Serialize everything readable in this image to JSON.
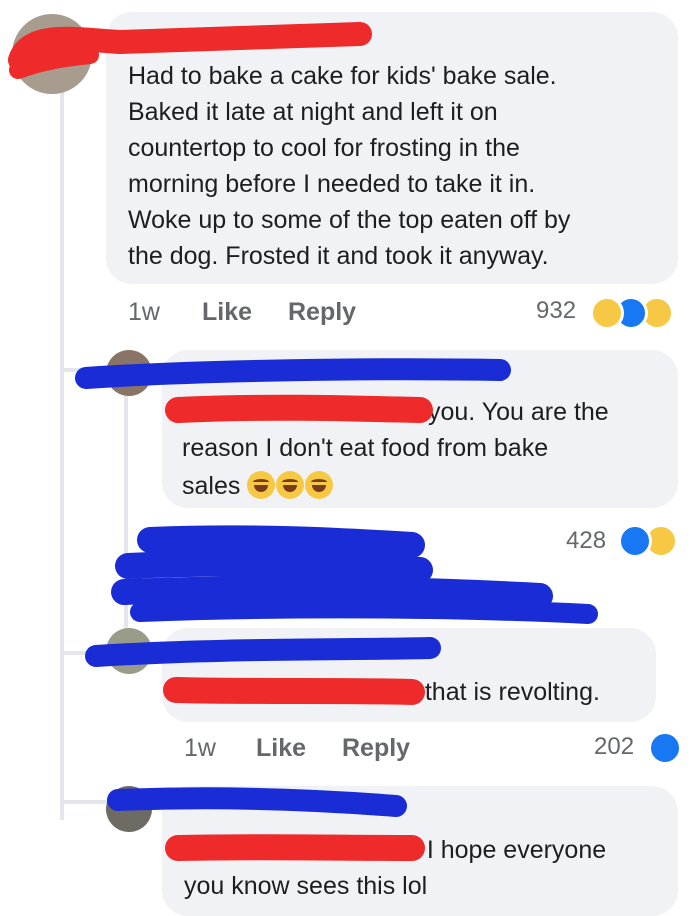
{
  "comments": [
    {
      "text_lines": [
        "Had to bake a cake for kids' bake sale.",
        "Baked it late at night and left it on",
        "countertop to cool for frosting in the",
        "morning before I needed to take it in.",
        "Woke up to some of the top eaten off by",
        "the dog.  Frosted it and took it anyway."
      ],
      "time": "1w",
      "like_label": "Like",
      "reply_label": "Reply",
      "reaction_count": "932",
      "reactions": [
        "haha",
        "like",
        "wow"
      ]
    },
    {
      "text_lines": [
        "you. You are the",
        "reason I don't eat food from bake",
        "sales"
      ],
      "emojis": [
        "tears-of-joy",
        "tears-of-joy",
        "tears-of-joy"
      ],
      "reaction_count": "428",
      "reactions": [
        "like",
        "haha"
      ]
    },
    {
      "text_lines": [
        "e that is revolting."
      ],
      "time": "1w",
      "like_label": "Like",
      "reply_label": "Reply",
      "reaction_count": "202",
      "reactions": [
        "like"
      ]
    },
    {
      "text_lines": [
        "e I hope everyone",
        "you know sees this lol"
      ]
    }
  ],
  "colors": {
    "bubble": "#f0f2f5",
    "redaction_red": "#ee2a2a",
    "redaction_blue": "#1a2cd6",
    "like_blue": "#1877f2"
  }
}
